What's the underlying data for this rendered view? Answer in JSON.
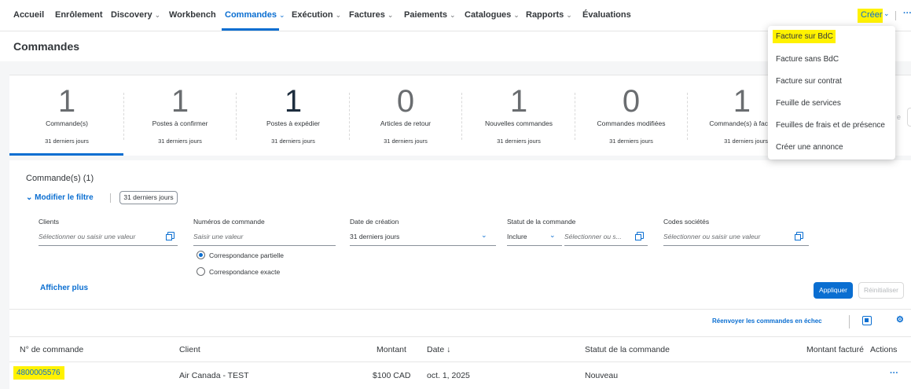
{
  "nav": {
    "items": [
      "Accueil",
      "Enrôlement",
      "Discovery",
      "Workbench",
      "Commandes",
      "Exécution",
      "Factures",
      "Paiements",
      "Catalogues",
      "Rapports",
      "Évaluations"
    ],
    "active": "Commandes",
    "create_label": "Créer",
    "more_label": "···",
    "colors": {
      "accent": "#0a6ed1",
      "highlight": "#fff200"
    }
  },
  "page_title": "Commandes",
  "kpis": [
    {
      "value": "1",
      "label": "Commande(s)",
      "period": "31 derniers jours"
    },
    {
      "value": "1",
      "label": "Postes à confirmer",
      "period": "31 derniers jours"
    },
    {
      "value": "1",
      "label": "Postes à expédier",
      "period": "31 derniers jours"
    },
    {
      "value": "0",
      "label": "Articles de retour",
      "period": "31 derniers jours"
    },
    {
      "value": "1",
      "label": "Nouvelles commandes",
      "period": "31 derniers jours"
    },
    {
      "value": "0",
      "label": "Commandes modifiées",
      "period": "31 derniers jours"
    },
    {
      "value": "1",
      "label": "Commande(s) à fac",
      "period": "31 derniers jours"
    }
  ],
  "filter": {
    "count_label": "Commande(s) (1)",
    "modify_label": "Modifier le filtre",
    "tag": "31 derniers jours",
    "clients_label": "Clients",
    "clients_placeholder": "Sélectionner ou saisir une valeur",
    "order_numbers_label": "Numéros de commande",
    "order_numbers_placeholder": "Saisir une valeur",
    "radio_partial": "Correspondance partielle",
    "radio_exact": "Correspondance exacte",
    "date_label": "Date de création",
    "date_value": "31 derniers jours",
    "status_label": "Statut de la commande",
    "status_include": "Inclure",
    "status_placeholder": "Sélectionner ou s...",
    "company_codes_label": "Codes sociétés",
    "company_codes_placeholder": "Sélectionner ou saisir une valeur",
    "show_more": "Afficher plus",
    "apply": "Appliquer",
    "reset": "Réinitialiser"
  },
  "table": {
    "resend_label": "Réenvoyer les commandes en échec",
    "headers": {
      "order_no": "N° de commande",
      "client": "Client",
      "amount": "Montant",
      "date": "Date ↓",
      "status": "Statut de la commande",
      "invoiced": "Montant facturé",
      "actions": "Actions"
    },
    "rows": [
      {
        "order_no": "4800005576",
        "client": "Air Canada - TEST",
        "amount": "$100 CAD",
        "date": "oct. 1, 2025",
        "status": "Nouveau",
        "invoiced": "",
        "actions": "···"
      }
    ]
  },
  "create_menu": {
    "items": [
      "Facture sur BdC",
      "Facture sans BdC",
      "Facture sur contrat",
      "Feuille de services",
      "Feuilles de frais et de présence",
      "Créer une annonce"
    ]
  },
  "right_stub": "e"
}
